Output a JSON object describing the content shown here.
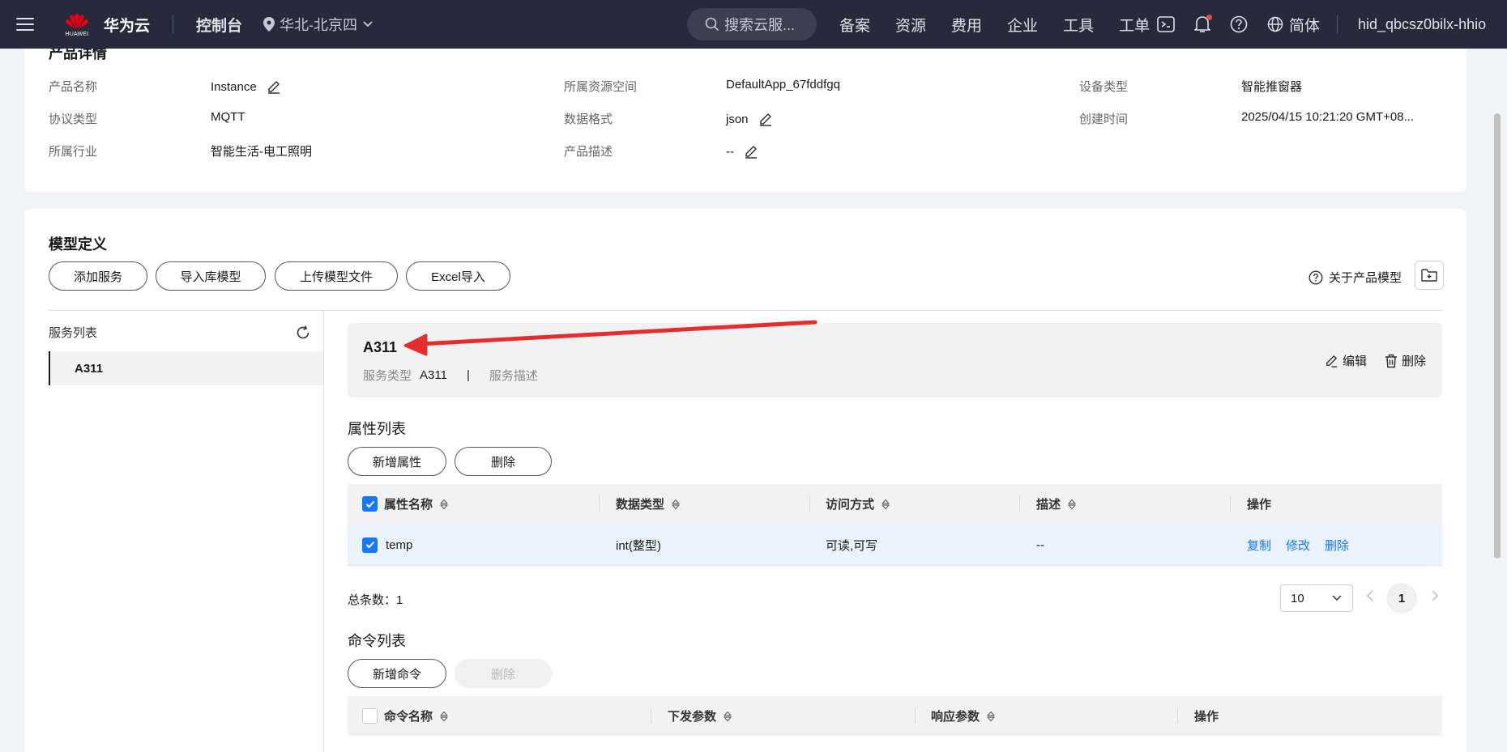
{
  "topnav": {
    "logo_text": "HUAWEI",
    "brand": "华为云",
    "console": "控制台",
    "region": "华北-北京四",
    "search_placeholder": "搜索云服...",
    "links": [
      "备案",
      "资源",
      "费用",
      "企业",
      "工具",
      "工单"
    ],
    "lang": "简体",
    "username": "hid_qbcsz0bilx-hhio"
  },
  "product": {
    "title": "产品详情",
    "fields": {
      "name_label": "产品名称",
      "name_value": "Instance",
      "space_label": "所属资源空间",
      "space_value": "DefaultApp_67fddfgq",
      "device_label": "设备类型",
      "device_value": "智能推窗器",
      "protocol_label": "协议类型",
      "protocol_value": "MQTT",
      "format_label": "数据格式",
      "format_value": "json",
      "created_label": "创建时间",
      "created_value": "2025/04/15 10:21:20 GMT+08...",
      "industry_label": "所属行业",
      "industry_value": "智能生活-电工照明",
      "desc_label": "产品描述",
      "desc_value": "--"
    }
  },
  "model": {
    "title": "模型定义",
    "buttons": {
      "add_service": "添加服务",
      "import_lib": "导入库模型",
      "upload_file": "上传模型文件",
      "excel_import": "Excel导入"
    },
    "about": "关于产品模型",
    "sidebar_title": "服务列表",
    "services": [
      "A311"
    ],
    "service": {
      "name": "A311",
      "type_label": "服务类型",
      "type_value": "A311",
      "sep": "|",
      "desc_label": "服务描述",
      "edit": "编辑",
      "delete": "删除"
    },
    "attributes": {
      "title": "属性列表",
      "add_button": "新增属性",
      "delete_button": "删除",
      "columns": [
        "属性名称",
        "数据类型",
        "访问方式",
        "描述",
        "操作"
      ],
      "rows": [
        {
          "name": "temp",
          "type": "int(整型)",
          "access": "可读,可写",
          "desc": "--",
          "actions": [
            "复制",
            "修改",
            "删除"
          ]
        }
      ],
      "total_label": "总条数：",
      "total": "1",
      "page_size": "10",
      "page": "1"
    },
    "commands": {
      "title": "命令列表",
      "add_button": "新增命令",
      "delete_button": "删除",
      "columns": [
        "命令名称",
        "下发参数",
        "响应参数",
        "操作"
      ]
    }
  },
  "colors": {
    "nav_bg": "#252b3a",
    "accent": "#1677ff",
    "arrow": "#e52d2d"
  }
}
